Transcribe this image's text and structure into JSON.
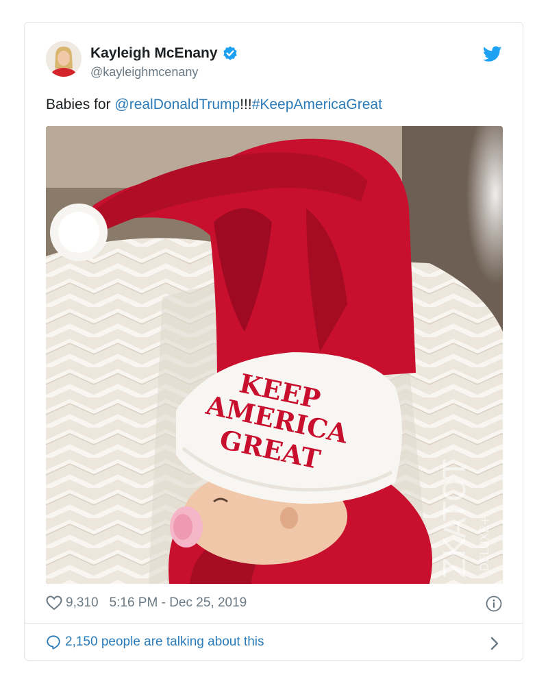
{
  "author": {
    "name": "Kayleigh McEnany",
    "handle": "@kayleighmcenany",
    "verified": true
  },
  "tweet": {
    "text_prefix": "Babies for ",
    "mention": "@realDonaldTrump",
    "bang": "!!!",
    "hashtag": "#KeepAmericaGreat"
  },
  "photo": {
    "hat_line1": "KEEP",
    "hat_line2": "AMERICA",
    "hat_line3": "GREAT",
    "watermark_main": "ZKATOT",
    "watermark_sub": "DELUXE+"
  },
  "meta": {
    "likes": "9,310",
    "timestamp": "5:16 PM - Dec 25, 2019"
  },
  "footer": {
    "talking": "2,150 people are talking about this"
  },
  "icons": {
    "verified": "verified-badge-icon",
    "brand": "twitter-bird-icon",
    "like": "heart-icon",
    "info": "info-icon",
    "reply": "speech-bubble-icon",
    "more": "chevron-right-icon"
  },
  "colors": {
    "link": "#2b7bb9",
    "verified": "#1da1f2",
    "text": "#1c2022",
    "muted": "#697882",
    "border": "#e1e8ed",
    "hat_red": "#c8102e"
  }
}
